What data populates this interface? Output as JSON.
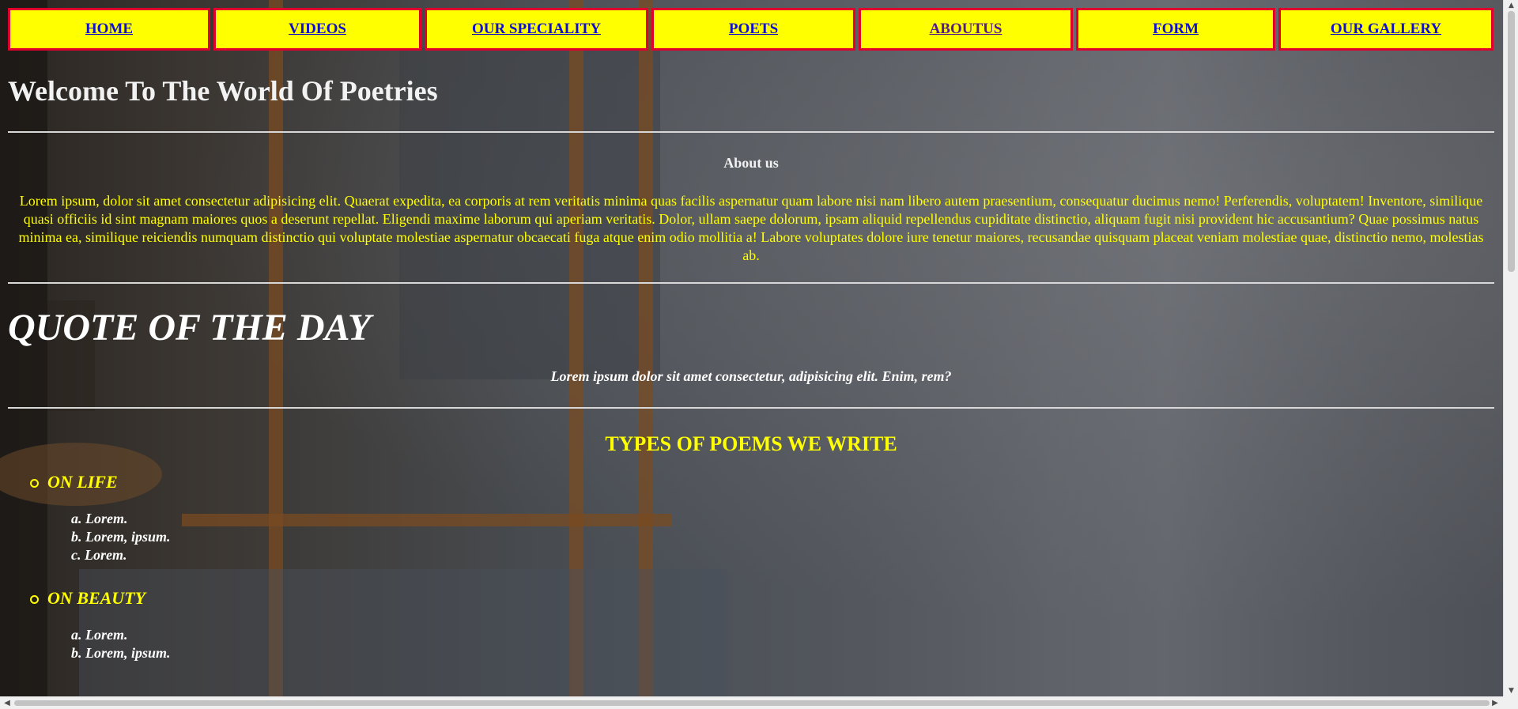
{
  "nav": {
    "items": [
      {
        "label": "HOME"
      },
      {
        "label": "VIDEOS"
      },
      {
        "label": "OUR SPECIALITY"
      },
      {
        "label": "POETS"
      },
      {
        "label": "ABOUTUS"
      },
      {
        "label": "FORM"
      },
      {
        "label": "OUR GALLERY"
      }
    ]
  },
  "welcome": {
    "title": "Welcome To The World Of Poetries"
  },
  "about": {
    "heading": "About us",
    "text": "Lorem ipsum, dolor sit amet consectetur adipisicing elit. Quaerat expedita, ea corporis at rem veritatis minima quas facilis aspernatur quam labore nisi nam libero autem praesentium, consequatur ducimus nemo! Perferendis, voluptatem! Inventore, similique quasi officiis id sint magnam maiores quos a deserunt repellat. Eligendi maxime laborum qui aperiam veritatis. Dolor, ullam saepe dolorum, ipsam aliquid repellendus cupiditate distinctio, aliquam fugit nisi provident hic accusantium? Quae possimus natus minima ea, similique reiciendis numquam distinctio qui voluptate molestiae aspernatur obcaecati fuga atque enim odio mollitia a! Labore voluptates dolore iure tenetur maiores, recusandae quisquam placeat veniam molestiae quae, distinctio nemo, molestias ab."
  },
  "quote": {
    "heading": "QUOTE OF THE DAY",
    "text": "Lorem ipsum dolor sit amet consectetur, adipisicing elit. Enim, rem?"
  },
  "types": {
    "heading": "TYPES OF POEMS WE WRITE",
    "categories": [
      {
        "label": "ON LIFE",
        "items": [
          "a. Lorem.",
          "b. Lorem, ipsum.",
          "c. Lorem."
        ]
      },
      {
        "label": "ON BEAUTY",
        "items": [
          "a. Lorem.",
          "b. Lorem, ipsum."
        ]
      }
    ]
  },
  "colors": {
    "nav_background": "#ffff00",
    "nav_border": "#e0002b",
    "link": "#1010cc",
    "visited_link": "#551a8b",
    "accent_text": "#ffff00",
    "heading_text": "#ffffff"
  },
  "scroll": {
    "vertical_position": 0
  }
}
